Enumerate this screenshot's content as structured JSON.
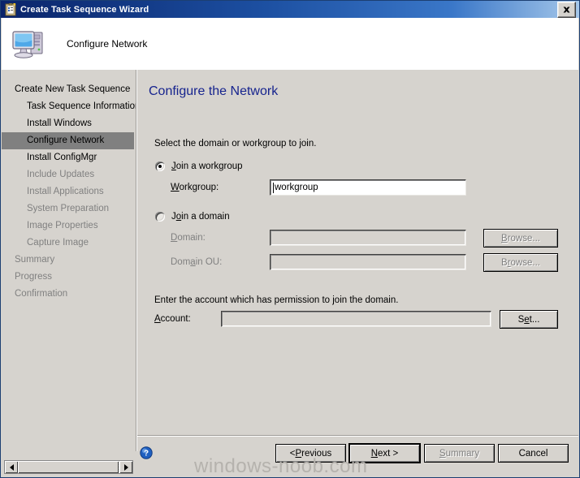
{
  "window": {
    "title": "Create Task Sequence Wizard",
    "title_icon": "task-sequence-clipboard-icon",
    "close_label": "Close"
  },
  "header": {
    "icon": "computer-icon",
    "title": "Configure Network"
  },
  "sidebar": {
    "items": [
      {
        "label": "Create New Task Sequence",
        "level": 0,
        "state": "normal"
      },
      {
        "label": "Task Sequence Information",
        "level": 1,
        "state": "normal"
      },
      {
        "label": "Install Windows",
        "level": 1,
        "state": "normal"
      },
      {
        "label": "Configure Network",
        "level": 1,
        "state": "selected"
      },
      {
        "label": "Install ConfigMgr",
        "level": 1,
        "state": "normal"
      },
      {
        "label": "Include Updates",
        "level": 1,
        "state": "dim"
      },
      {
        "label": "Install Applications",
        "level": 1,
        "state": "dim"
      },
      {
        "label": "System Preparation",
        "level": 1,
        "state": "dim"
      },
      {
        "label": "Image Properties",
        "level": 1,
        "state": "dim"
      },
      {
        "label": "Capture Image",
        "level": 1,
        "state": "dim"
      },
      {
        "label": "Summary",
        "level": 0,
        "state": "dim"
      },
      {
        "label": "Progress",
        "level": 0,
        "state": "dim"
      },
      {
        "label": "Confirmation",
        "level": 0,
        "state": "dim"
      }
    ]
  },
  "content": {
    "page_title": "Configure the Network",
    "page_title_color": "#16238e",
    "intro_text": "Select the domain or workgroup to join.",
    "account_text": "Enter the account which has permission to join the domain.",
    "radio_workgroup": {
      "label": "Join a workgroup",
      "selected": true
    },
    "radio_domain": {
      "label": "Join a domain",
      "selected": false
    },
    "fields": {
      "workgroup": {
        "label": "Workgroup:",
        "value": "workgroup",
        "placeholder": "",
        "disabled": false
      },
      "domain": {
        "label": "Domain:",
        "value": "",
        "placeholder": "",
        "disabled": true
      },
      "domain_ou": {
        "label": "Domain OU:",
        "value": "",
        "placeholder": "",
        "disabled": true
      },
      "account": {
        "label": "Account:",
        "value": "",
        "placeholder": "",
        "disabled": true
      }
    },
    "buttons": {
      "browse_domain": "Browse...",
      "browse_domain_ou": "Browse...",
      "set_account": "Set..."
    }
  },
  "footer": {
    "help_icon": "help-question-icon",
    "previous": "< Previous",
    "next": "Next >",
    "summary": "Summary",
    "cancel": "Cancel"
  },
  "watermark": "windows-noob.com",
  "scrollbar": {
    "left_arrow": "scroll-left-icon",
    "right_arrow": "scroll-right-icon"
  }
}
